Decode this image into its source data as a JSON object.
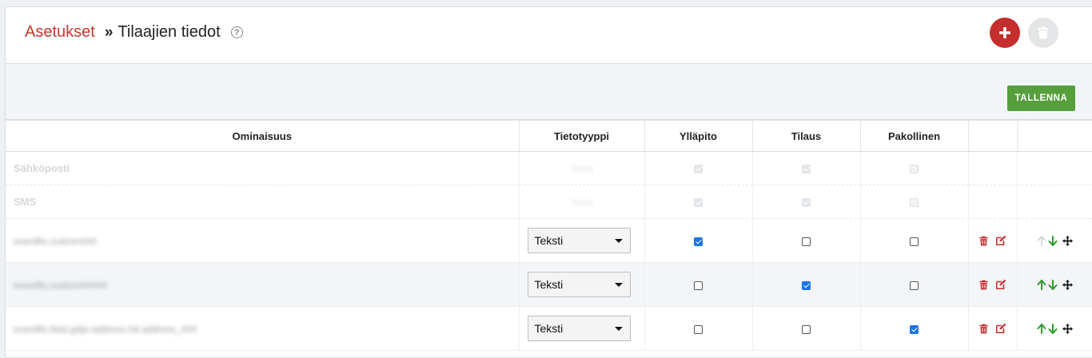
{
  "header": {
    "breadcrumb_parent": "Asetukset",
    "breadcrumb_separator": "»",
    "breadcrumb_current": "Tilaajien tiedot",
    "help_icon": "question-circle-icon",
    "add_icon": "plus-icon",
    "delete_icon": "trash-icon"
  },
  "toolbar": {
    "save_label": "TALLENNA"
  },
  "table": {
    "columns": [
      "Ominaisuus",
      "Tietotyyppi",
      "Ylläpito",
      "Tilaus",
      "Pakollinen",
      "",
      ""
    ],
    "system_rows": [
      {
        "name": "Sähköposti",
        "type": "Teksti",
        "yllapito": true,
        "tilaus": true,
        "pakollinen": false
      },
      {
        "name": "SMS",
        "type": "Teksti",
        "yllapito": true,
        "tilaus": true,
        "pakollinen": false
      }
    ],
    "rows": [
      {
        "name": "eventflo.custom###",
        "type": "Teksti",
        "yllapito": true,
        "tilaus": false,
        "pakollinen": false,
        "up_enabled": false,
        "down_enabled": true
      },
      {
        "name": "eventflo.custom#####",
        "type": "Teksti",
        "yllapito": false,
        "tilaus": true,
        "pakollinen": false,
        "up_enabled": true,
        "down_enabled": true
      },
      {
        "name": "eventflo.field.gdpr.address.hd.address_###",
        "type": "Teksti",
        "yllapito": false,
        "tilaus": false,
        "pakollinen": true,
        "up_enabled": true,
        "down_enabled": true
      }
    ]
  },
  "colors": {
    "accent_red": "#c62d2d",
    "save_green": "#55a03c",
    "arrow_green": "#2e9a2e",
    "checkbox_blue": "#1a73e8"
  }
}
